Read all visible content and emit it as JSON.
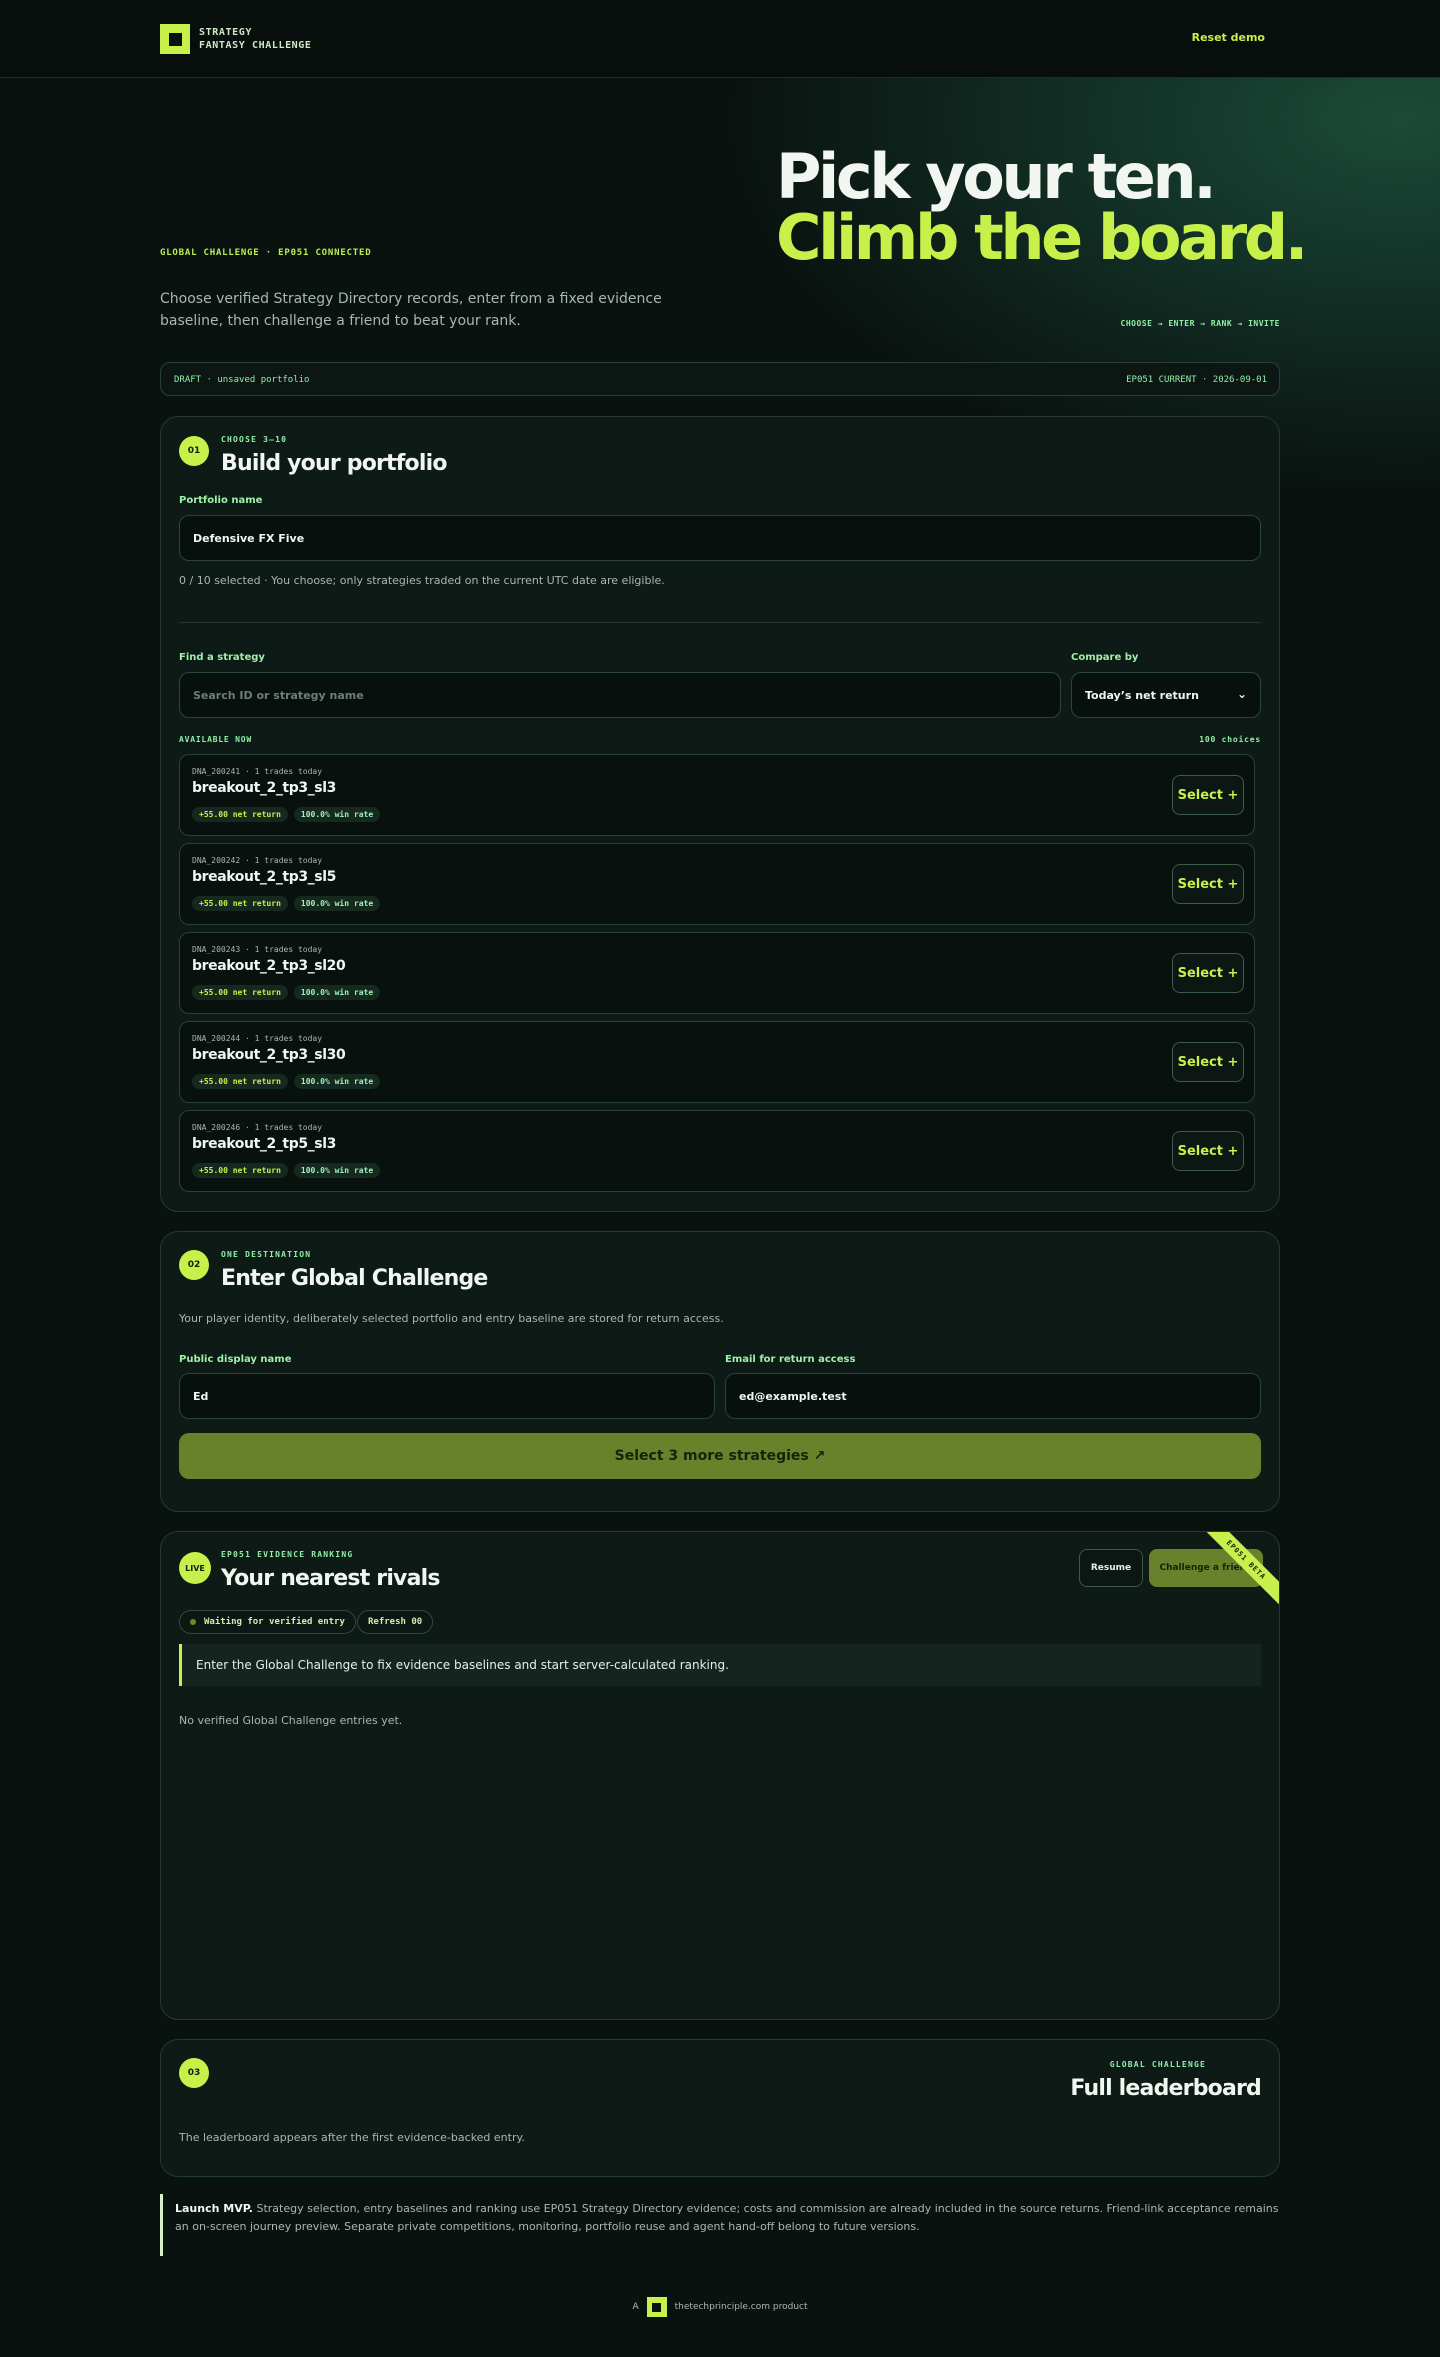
{
  "brand": {
    "line1": "STRATEGY",
    "line2": "FANTASY CHALLENGE",
    "logo_icon": "square-logo-icon",
    "accent": "#c8f04a"
  },
  "header": {
    "reset_label": "Reset demo"
  },
  "hero": {
    "title_line1": "Pick your ten.",
    "title_line2": "Climb the board.",
    "kicker": "GLOBAL CHALLENGE · EP051 CONNECTED",
    "lede": "Choose verified Strategy Directory records, enter from a fixed evidence baseline, then challenge a friend to beat your rank.",
    "steps": "CHOOSE → ENTER → RANK → INVITE"
  },
  "status": {
    "left": "DRAFT · unsaved portfolio",
    "right": "EP051 CURRENT · 2026-09-01"
  },
  "build": {
    "step": "01",
    "kicker": "CHOOSE 3–10",
    "title": "Build your portfolio",
    "portfolio_label": "Portfolio name",
    "portfolio_value": "Defensive FX Five",
    "selection_note": "0 / 10 selected · You choose; only strategies traded on the current UTC date are eligible.",
    "find_label": "Find a strategy",
    "search_placeholder": "Search ID or strategy name",
    "compare_label": "Compare by",
    "compare_value": "Today’s net return",
    "available_label": "AVAILABLE NOW",
    "choices_count": "100 choices",
    "select_label": "Select +",
    "strategies": [
      {
        "meta": "DNA_200241 · 1 trades today",
        "name": "breakout_2_tp3_sl3",
        "net": "+55.00 net return",
        "win": "100.0% win rate"
      },
      {
        "meta": "DNA_200242 · 1 trades today",
        "name": "breakout_2_tp3_sl5",
        "net": "+55.00 net return",
        "win": "100.0% win rate"
      },
      {
        "meta": "DNA_200243 · 1 trades today",
        "name": "breakout_2_tp3_sl20",
        "net": "+55.00 net return",
        "win": "100.0% win rate"
      },
      {
        "meta": "DNA_200244 · 1 trades today",
        "name": "breakout_2_tp3_sl30",
        "net": "+55.00 net return",
        "win": "100.0% win rate"
      },
      {
        "meta": "DNA_200246 · 1 trades today",
        "name": "breakout_2_tp5_sl3",
        "net": "+55.00 net return",
        "win": "100.0% win rate"
      }
    ]
  },
  "enter": {
    "step": "02",
    "kicker": "ONE DESTINATION",
    "title": "Enter Global Challenge",
    "note": "Your player identity, deliberately selected portfolio and entry baseline are stored for return access.",
    "name_label": "Public display name",
    "name_value": "Ed",
    "email_label": "Email for return access",
    "email_value": "ed@example.test",
    "cta": "Select 3 more strategies ↗"
  },
  "rivals": {
    "badge": "LIVE",
    "kicker": "EP051 EVIDENCE RANKING",
    "title": "Your nearest rivals",
    "resume_label": "Resume",
    "challenge_label": "Challenge a friend",
    "ribbon": "EP051 BETA",
    "waiting_pill": "Waiting for verified entry",
    "refresh_pill": "Refresh 00",
    "callout": "Enter the Global Challenge to fix evidence baselines and start server-calculated ranking.",
    "empty": "No verified Global Challenge entries yet."
  },
  "leaderboard": {
    "step": "03",
    "kicker": "GLOBAL CHALLENGE",
    "title": "Full leaderboard",
    "note": "The leaderboard appears after the first evidence-backed entry."
  },
  "footer": {
    "mvp_title": "Launch MVP.",
    "mvp_text": " Strategy selection, entry baselines and ranking use EP051 Strategy Directory evidence; costs and commission are already included in the source returns. Friend-link acceptance remains an on-screen journey preview. Separate private competitions, monitoring, portfolio reuse and agent hand-off belong to future versions.",
    "credit_prefix": "A",
    "credit_text": "thetechprinciple.com product"
  }
}
